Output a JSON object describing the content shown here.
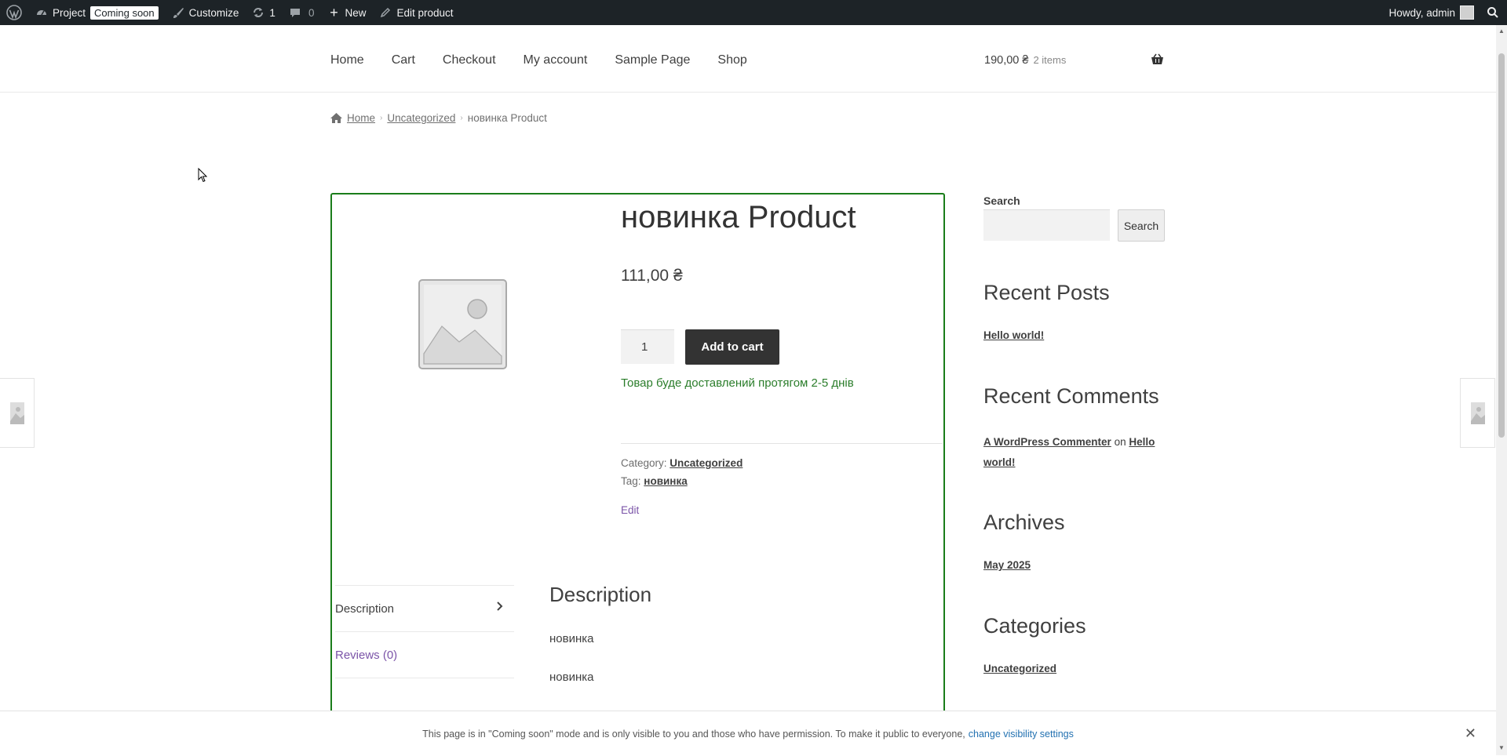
{
  "admin_bar": {
    "site_name": "Project",
    "coming_soon_badge": "Coming soon",
    "customize": "Customize",
    "updates_count": "1",
    "comments_count": "0",
    "new": "New",
    "edit_product": "Edit product",
    "howdy": "Howdy, admin"
  },
  "nav": {
    "items": [
      "Home",
      "Cart",
      "Checkout",
      "My account",
      "Sample Page",
      "Shop"
    ]
  },
  "cart": {
    "total": "190,00 ₴",
    "count": "2 items"
  },
  "breadcrumb": {
    "home": "Home",
    "category": "Uncategorized",
    "current": "новинка Product"
  },
  "product": {
    "title": "новинка Product",
    "price": "111,00 ₴",
    "quantity": "1",
    "add_to_cart": "Add to cart",
    "delivery_note": "Товар буде доставлений протягом 2-5 днів",
    "category_label": "Category:",
    "category": "Uncategorized",
    "tag_label": "Tag:",
    "tag": "новинка",
    "edit": "Edit"
  },
  "tabs": {
    "description": "Description",
    "reviews": "Reviews (0)"
  },
  "description": {
    "heading": "Description",
    "paragraphs": [
      "новинка",
      "новинка"
    ]
  },
  "sidebar": {
    "search_label": "Search",
    "search_button": "Search",
    "search_placeholder": "",
    "recent_posts_title": "Recent Posts",
    "recent_posts": [
      "Hello world!"
    ],
    "recent_comments_title": "Recent Comments",
    "comment_author": "A WordPress Commenter",
    "comment_on": "on",
    "comment_post": "Hello world!",
    "archives_title": "Archives",
    "archives": [
      "May 2025"
    ],
    "categories_title": "Categories",
    "categories": [
      "Uncategorized"
    ]
  },
  "notice": {
    "text": "This page is in \"Coming soon\" mode and is only visible to you and those who have permission. To make it public to everyone,",
    "link": "change visibility settings"
  },
  "colors": {
    "admin_bar_bg": "#1d2327",
    "product_border": "#1a7d1a",
    "add_to_cart_bg": "#333333",
    "delivery_text": "#2a7d2a",
    "link_purple": "#7b54a8",
    "notice_link": "#2271b1"
  }
}
